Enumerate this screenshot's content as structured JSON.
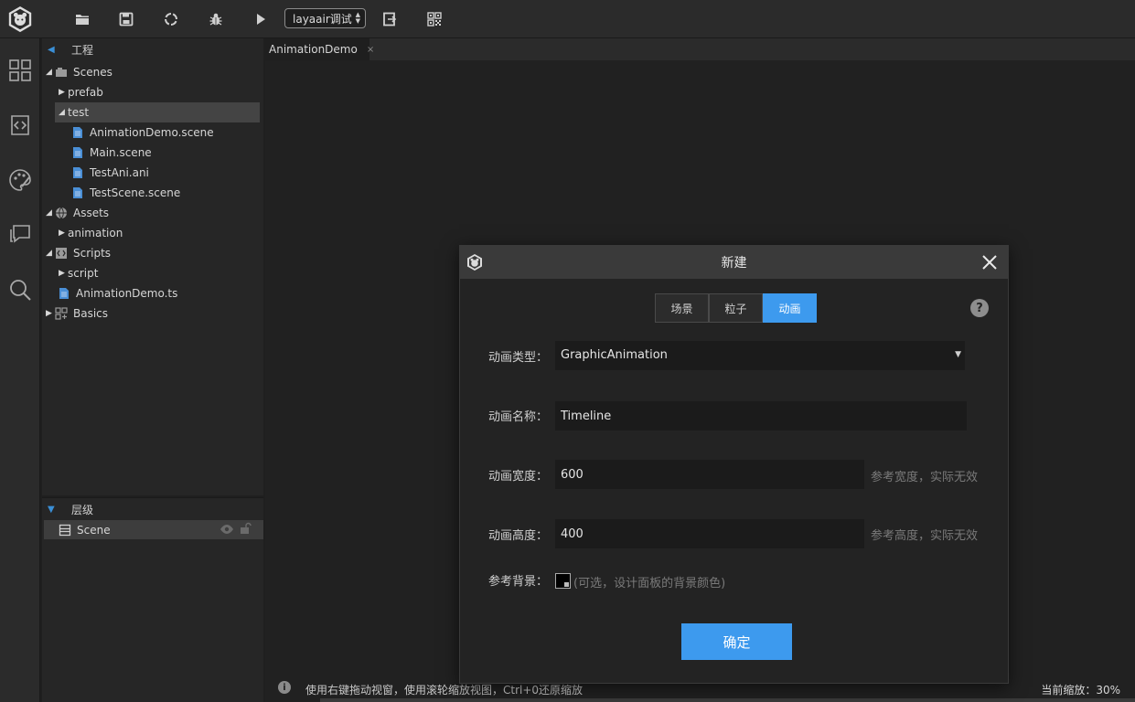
{
  "toolbar": {
    "debug_select": "layaair调试",
    "icons": [
      "app-logo-icon",
      "folder-icon",
      "save-icon",
      "publish-icon",
      "bug-icon",
      "play-icon",
      "export-icon",
      "qrcode-icon"
    ]
  },
  "rail": {
    "icons": [
      "grid-icon",
      "code-icon",
      "palette-icon",
      "comment-icon",
      "search-icon"
    ]
  },
  "project_panel": {
    "title": "工程",
    "items": [
      {
        "label": "Scenes",
        "expanded": true,
        "icon": "scenes-icon"
      },
      {
        "label": "prefab",
        "expanded": false
      },
      {
        "label": "test",
        "expanded": true,
        "selected": true
      },
      {
        "label": "AnimationDemo.scene",
        "icon": "file-icon"
      },
      {
        "label": "Main.scene",
        "icon": "file-icon"
      },
      {
        "label": "TestAni.ani",
        "icon": "file-icon"
      },
      {
        "label": "TestScene.scene",
        "icon": "file-icon"
      },
      {
        "label": "Assets",
        "expanded": true,
        "icon": "assets-icon"
      },
      {
        "label": "animation",
        "expanded": false
      },
      {
        "label": "Scripts",
        "expanded": true,
        "icon": "scripts-icon"
      },
      {
        "label": "script",
        "expanded": false
      },
      {
        "label": "AnimationDemo.ts",
        "icon": "file-icon"
      },
      {
        "label": "Basics",
        "expanded": false,
        "icon": "basics-icon"
      }
    ]
  },
  "layer_panel": {
    "title": "层级",
    "scene_label": "Scene"
  },
  "editor": {
    "tab_label": "AnimationDemo",
    "tab_close": "×",
    "status_tip": "使用右键拖动视窗，使用滚轮缩放视图，Ctrl+0还原缩放",
    "zoom": "当前缩放：30%"
  },
  "dialog": {
    "title": "新建",
    "tabs": [
      "场景",
      "粒子",
      "动画"
    ],
    "active_tab": 2,
    "fields": {
      "type_label": "动画类型：",
      "type_value": "GraphicAnimation",
      "name_label": "动画名称：",
      "name_value": "Timeline",
      "width_label": "动画宽度：",
      "width_value": "600",
      "width_hint": "参考宽度，实际无效",
      "height_label": "动画高度：",
      "height_value": "400",
      "height_hint": "参考高度，实际无效",
      "bg_label": "参考背景：",
      "bg_hint": "(可选，设计面板的背景颜色)"
    },
    "ok_label": "确定",
    "help": "?"
  },
  "colors": {
    "accent": "#3d9aee",
    "panel_bg": "#262626",
    "toolbar_bg": "#2b2b2b"
  }
}
